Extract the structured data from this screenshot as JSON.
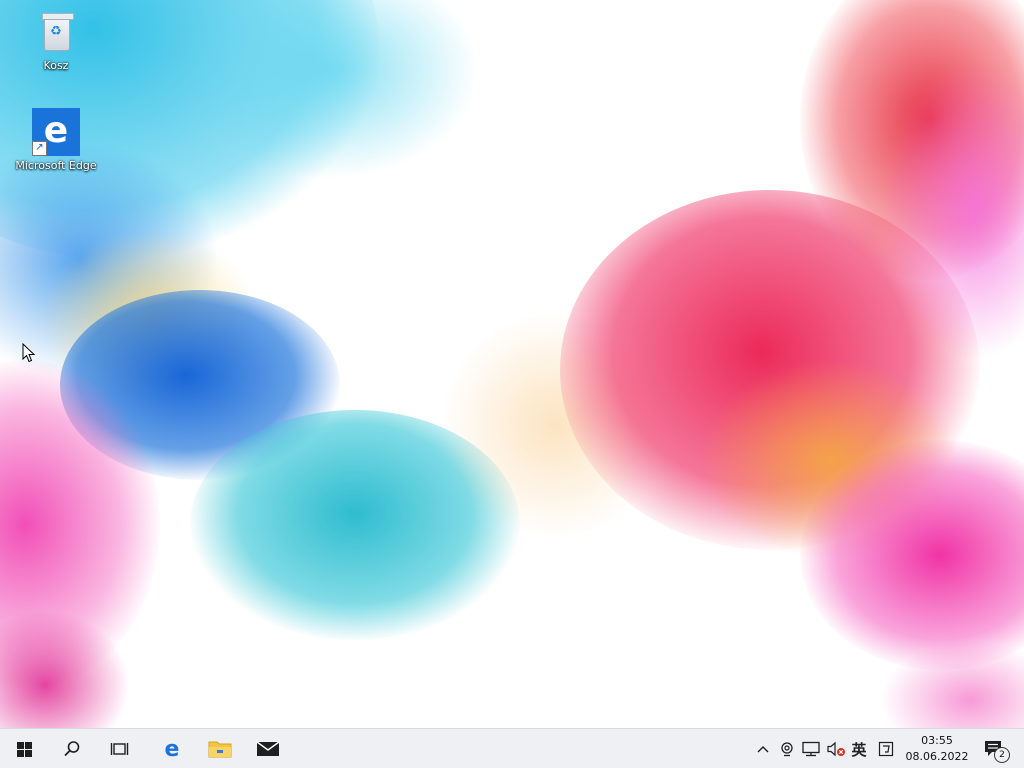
{
  "desktop": {
    "icons": [
      {
        "label": "Kosz",
        "icon": "recycle-bin-icon"
      },
      {
        "label": "Microsoft Edge",
        "icon": "edge-icon"
      }
    ]
  },
  "taskbar": {
    "start_icon": "windows-logo-icon",
    "search_icon": "search-icon",
    "taskview_icon": "task-view-icon",
    "pinned": [
      {
        "name": "Microsoft Edge",
        "icon": "edge-icon"
      },
      {
        "name": "File Explorer",
        "icon": "folder-icon"
      },
      {
        "name": "Mail",
        "icon": "mail-icon"
      }
    ],
    "tray": {
      "ime_label": "英",
      "clock_time": "03:55",
      "clock_date": "08.06.2022",
      "notification_count": "2"
    }
  },
  "colors": {
    "taskbar_bg": "#eef0f3",
    "edge_blue": "#1a73d9",
    "folder_yellow": "#f4c542"
  }
}
